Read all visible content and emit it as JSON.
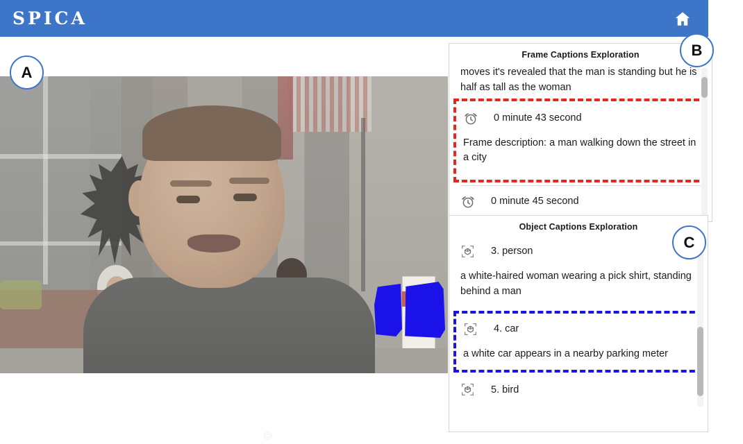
{
  "header": {
    "brand": "SPICA",
    "home_icon": "home-icon",
    "bg_color": "#3d76c8"
  },
  "callouts": {
    "a": "A",
    "b": "B",
    "c": "C",
    "border_color": "#3d76c8"
  },
  "video": {
    "region_label": "video-frame-viewer",
    "mask_color": "#1a12e8",
    "mask_object_label": "car"
  },
  "frame_panel": {
    "title": "Frame Captions Exploration",
    "clipped_caption": "moves it's revealed that the man is standing but he is half as tall as the woman",
    "highlighted_entry": {
      "icon": "alarm-clock-icon",
      "timestamp": "0 minute 43 second",
      "description": "Frame description: a man walking down the street in a city",
      "highlight_color": "#e8271c"
    },
    "next_entry": {
      "icon": "alarm-clock-icon",
      "timestamp": "0 minute 45 second"
    }
  },
  "object_panel": {
    "title": "Object Captions Exploration",
    "items": [
      {
        "icon": "cube-object-icon",
        "label": "3. person",
        "description": "a white-haired woman wearing a pick shirt, standing behind a man",
        "highlighted": false
      },
      {
        "icon": "cube-object-icon",
        "label": "4. car",
        "description": "a white car appears in a nearby parking meter",
        "highlighted": true,
        "highlight_color": "#1a12e8"
      },
      {
        "icon": "cube-object-icon",
        "label": "5. bird",
        "description": "",
        "highlighted": false
      }
    ]
  }
}
